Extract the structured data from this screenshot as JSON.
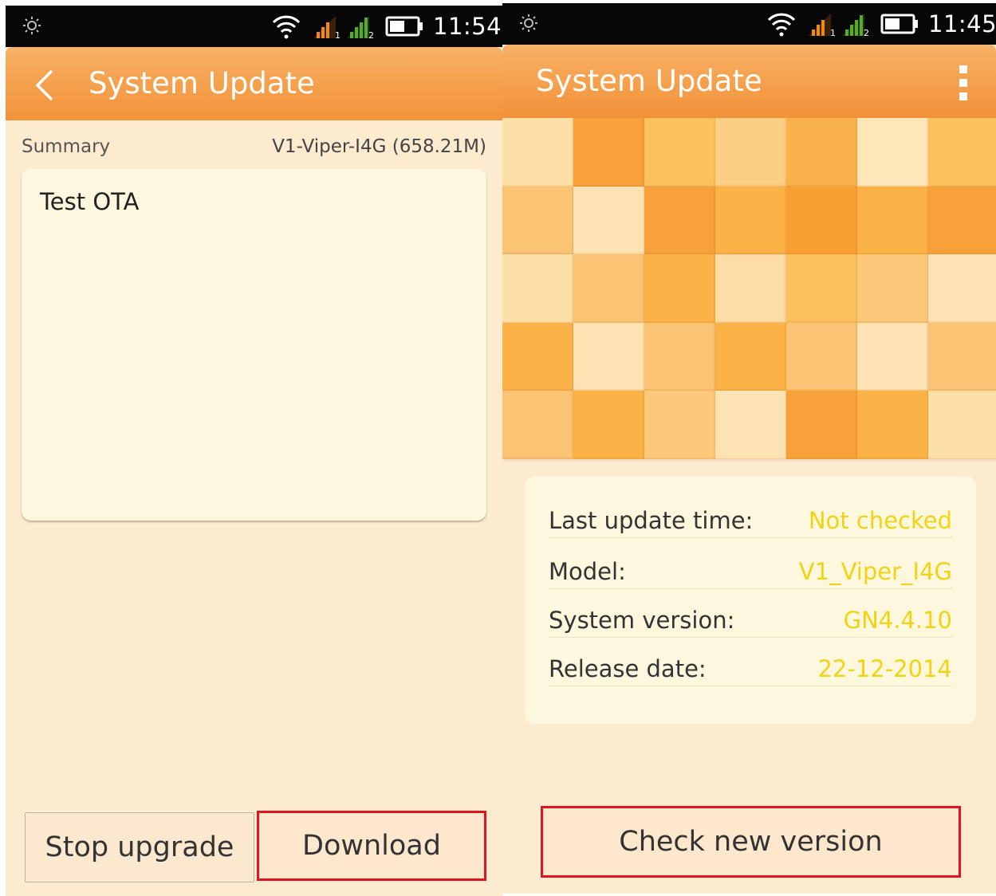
{
  "left": {
    "status": {
      "time": "11:54"
    },
    "header": {
      "title": "System Update"
    },
    "summary": {
      "label": "Summary",
      "version": "V1-Viper-I4G (658.21M)"
    },
    "notes": "Test OTA",
    "buttons": {
      "stop": "Stop upgrade",
      "download": "Download"
    }
  },
  "right": {
    "status": {
      "time": "11:45"
    },
    "header": {
      "title": "System Update"
    },
    "info": {
      "last_update_label": "Last update time:",
      "last_update_value": "Not checked",
      "model_label": "Model:",
      "model_value": "V1_Viper_I4G",
      "system_version_label": "System version:",
      "system_version_value": "GN4.4.10",
      "release_date_label": "Release date:",
      "release_date_value": "22-12-2014"
    },
    "buttons": {
      "check": "Check new version"
    }
  },
  "colors": {
    "accent": "#f5a24f",
    "background": "#fdebd0",
    "value_yellow": "#f1d313",
    "highlight_red": "#e0141c"
  },
  "icons": [
    "brightness-icon",
    "wifi-icon",
    "signal-sim1-icon",
    "signal-sim2-icon",
    "battery-icon",
    "back-arrow-icon",
    "overflow-menu-icon"
  ],
  "mosaic_colors": [
    "#fde0a8",
    "#f8a13a",
    "#fbc15d",
    "#fbcf84",
    "#f9b24c",
    "#fde6b8",
    "#fbc15d",
    "#fbc374",
    "#fde3b4",
    "#f8a13a",
    "#fbb246",
    "#f9a035",
    "#fbb246",
    "#f8a13a",
    "#fde0a8",
    "#fbc374",
    "#fbb246",
    "#fddca5",
    "#fbc15d",
    "#fbc979",
    "#fde3b4",
    "#fbb246",
    "#fde3b4",
    "#fbc374",
    "#fbb246",
    "#fbc374",
    "#fde3b4",
    "#fbc374",
    "#fbc374",
    "#fbb246",
    "#fbc979",
    "#fde3b4",
    "#f8a13a",
    "#fbb246",
    "#fde0a8"
  ]
}
